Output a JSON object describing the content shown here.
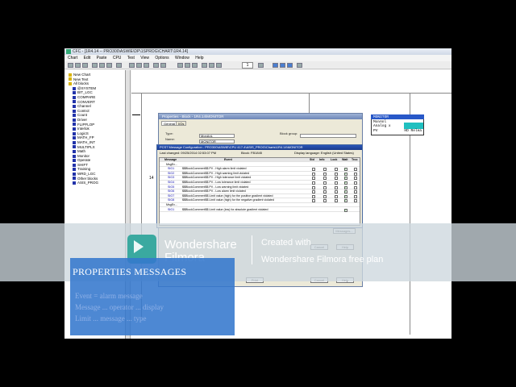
{
  "window": {
    "title": "CFC - [1R4.14 -- PRO300\\ASWIE\\DP\\1SPROG\\CHART\\1R4.14]"
  },
  "menu": [
    "Chart",
    "Edit",
    "Paste",
    "CPU",
    "Test",
    "View",
    "Options",
    "Window",
    "Help"
  ],
  "toolbar": {
    "zoom": "1"
  },
  "tree": {
    "items": [
      {
        "label": "New Chart",
        "icon": "chart-icon"
      },
      {
        "label": "New Text",
        "icon": "text-icon"
      },
      {
        "label": "All blocks",
        "icon": "folder-icon"
      },
      {
        "label": "@SYSTEM",
        "icon": "library-icon"
      },
      {
        "label": "BIT_LGC",
        "icon": "library-icon"
      },
      {
        "label": "COMPARE",
        "icon": "library-icon"
      },
      {
        "label": "CONVERT",
        "icon": "library-icon"
      },
      {
        "label": "Channel",
        "icon": "library-icon"
      },
      {
        "label": "Control",
        "icon": "library-icon"
      },
      {
        "label": "Count",
        "icon": "library-icon"
      },
      {
        "label": "Driver",
        "icon": "library-icon"
      },
      {
        "label": "FLIPFLOP",
        "icon": "library-icon"
      },
      {
        "label": "Interlok",
        "icon": "library-icon"
      },
      {
        "label": "LogicS",
        "icon": "library-icon"
      },
      {
        "label": "MATH_FP",
        "icon": "library-icon"
      },
      {
        "label": "MATH_INT",
        "icon": "library-icon"
      },
      {
        "label": "MULTIPLX",
        "icon": "library-icon"
      },
      {
        "label": "Math",
        "icon": "library-icon"
      },
      {
        "label": "Monitor",
        "icon": "library-icon"
      },
      {
        "label": "Operate",
        "icon": "library-icon"
      },
      {
        "label": "SHIFT",
        "icon": "library-icon"
      },
      {
        "label": "Training",
        "icon": "library-icon"
      },
      {
        "label": "WRD_LGC",
        "icon": "library-icon"
      },
      {
        "label": "Other blocks",
        "icon": "library-icon"
      },
      {
        "label": "ASIS_PROG",
        "icon": "library-icon"
      }
    ]
  },
  "chart": {
    "block_input": {
      "lines": [
        "Input1",
        "PreValu",
        "Analog x",
        "PV In"
      ],
      "out": "Rel"
    },
    "block_monitor": {
      "lines": [
        "MONITOR",
        "MonAnl",
        "Analog x",
        "PV"
      ],
      "out": "HD Relea"
    },
    "row_marker": "14"
  },
  "properties_dialog": {
    "title": "Properties - Block - 1R4.14\\MONITOR",
    "tabs": [
      "General",
      "I/Os"
    ],
    "type_label": "Type:",
    "type_value": "MonAnL",
    "name_label": "Name:",
    "name_value": "MONITOR",
    "block_group_label": "Block group:",
    "messages_button": "Messages...",
    "cancel_button": "Cancel",
    "help_button": "Help",
    "print_button": "Print",
    "cancel_button2": "Cancel",
    "help_button2": "Help"
  },
  "pcs7_dialog": {
    "title": "PCS7 Message Configuration - PRO300\\ASWIE\\CPU 417-4\\ASIS_PROG\\Charts\\1R4.14\\MONITOR",
    "last_changed": "Last changed: 09/25/2014 02:53:07 PM",
    "block": "Block: FB1845",
    "display_language": "Display language: English (United States)",
    "columns": [
      "Message",
      "Event",
      "Std",
      "Info",
      "Lock",
      "Wait",
      "Troc"
    ],
    "group_label": "MsgEv...",
    "rows": [
      {
        "id": "SIG1",
        "event": "$$BlockComment$$ PV - High alarm limit violated",
        "std": false,
        "info": false,
        "lock": false,
        "wait": true,
        "troc": false
      },
      {
        "id": "SIG2",
        "event": "$$BlockComment$$ PV - High warning limit violated",
        "std": false,
        "info": false,
        "lock": false,
        "wait": true,
        "troc": false
      },
      {
        "id": "SIG3",
        "event": "$$BlockComment$$ PV - High tolerance limit violated",
        "std": false,
        "info": false,
        "lock": false,
        "wait": true,
        "troc": false
      },
      {
        "id": "SIG4",
        "event": "$$BlockComment$$ PV - Low tolerance limit violated",
        "std": false,
        "info": false,
        "lock": false,
        "wait": true,
        "troc": false
      },
      {
        "id": "SIG5",
        "event": "$$BlockComment$$ PV - Low warning limit violated",
        "std": false,
        "info": false,
        "lock": false,
        "wait": true,
        "troc": false
      },
      {
        "id": "SIG6",
        "event": "$$BlockComment$$ PV - Low alarm limit violated",
        "std": false,
        "info": false,
        "lock": false,
        "wait": true,
        "troc": false
      },
      {
        "id": "SIG7",
        "event": "$$BlockComment$$ Limit value (high) for the positive gradient violated",
        "std": false,
        "info": false,
        "lock": false,
        "wait": true,
        "troc": false
      },
      {
        "id": "SIG8",
        "event": "$$BlockComment$$ Limit value (high) for the negative gradient violated",
        "std": false,
        "info": false,
        "lock": false,
        "wait": true,
        "troc": false
      }
    ],
    "group_label2": "MsgEv...",
    "extra_row": {
      "id": "SIG1",
      "event": "$$BlockComment$$ Limit value (low) for absolute gradient violated",
      "wait": true
    }
  },
  "watermark": {
    "brand": "Wondershare",
    "product": "Filmora",
    "created_with": "Created with",
    "plan": "Wondershare Filmora free plan"
  },
  "caption_panel": {
    "title": "PROPERTIES  MESSAGES",
    "lines": [
      "Event = alarm message",
      "Message ... operator ... display",
      "Limit ... message ... type"
    ]
  },
  "colors": {
    "accent_cyan": "#20c0c0",
    "title_blue": "#1a3c8c",
    "overlay_blue": "#3478cd"
  }
}
